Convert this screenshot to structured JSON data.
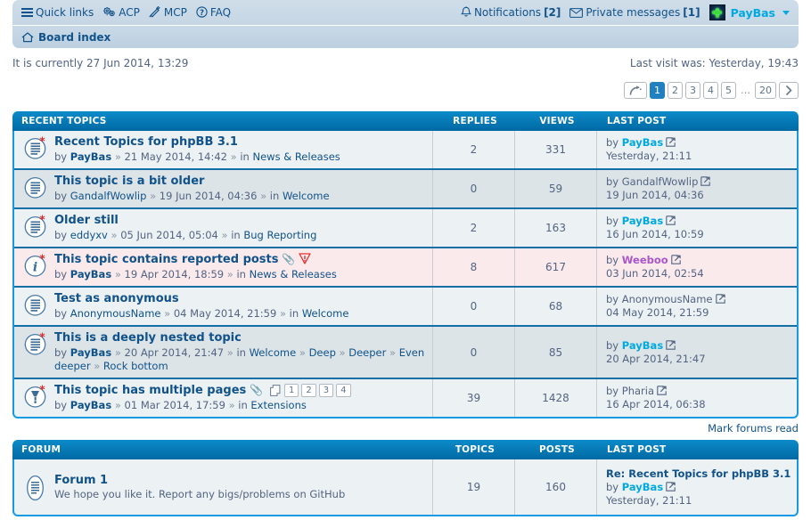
{
  "navbar": {
    "quick_links": "Quick links",
    "acp": "ACP",
    "mcp": "MCP",
    "faq": "FAQ",
    "notifications_label": "Notifications",
    "notifications_count": "[2]",
    "private_messages_label": "Private messages",
    "private_messages_count": "[1]",
    "username": "PayBas"
  },
  "breadcrumb": {
    "board_index": "Board index"
  },
  "info": {
    "current_time": "It is currently 27 Jun 2014, 13:29",
    "last_visit": "Last visit was: Yesterday, 19:43"
  },
  "pagination": {
    "pages": [
      "1",
      "2",
      "3",
      "4",
      "5"
    ],
    "ellipsis": "…",
    "last_page": "20",
    "active": "1"
  },
  "recent_topics": {
    "header": {
      "title": "RECENT TOPICS",
      "replies": "REPLIES",
      "views": "VIEWS",
      "last_post": "LAST POST"
    },
    "rows": [
      {
        "icon": "topic-unread",
        "title": "Recent Topics for phpBB 3.1",
        "by": "by",
        "author": "PayBas",
        "author_style": "strong",
        "date": "21 May 2014, 14:42",
        "in": "in",
        "forum_path": [
          "News & Releases"
        ],
        "attachment": false,
        "reported": false,
        "replies": "2",
        "views": "331",
        "lastpost_by": "by",
        "lastpost_author": "PayBas",
        "lastpost_author_style": "strong",
        "lastpost_time": "Yesterday, 21:11",
        "mini_pages": []
      },
      {
        "icon": "topic-read",
        "title": "This topic is a bit older",
        "by": "by",
        "author": "GandalfWowlip",
        "author_style": "plain",
        "date": "19 Jun 2014, 04:36",
        "in": "in",
        "forum_path": [
          "Welcome"
        ],
        "attachment": false,
        "reported": false,
        "replies": "0",
        "views": "59",
        "lastpost_by": "by",
        "lastpost_author": "GandalfWowlip",
        "lastpost_author_style": "plain",
        "lastpost_time": "19 Jun 2014, 04:36",
        "mini_pages": []
      },
      {
        "icon": "topic-unread",
        "title": "Older still",
        "by": "by",
        "author": "eddyxv",
        "author_style": "plain",
        "date": "05 Jun 2014, 05:04",
        "in": "in",
        "forum_path": [
          "Bug Reporting"
        ],
        "attachment": false,
        "reported": false,
        "replies": "2",
        "views": "163",
        "lastpost_by": "by",
        "lastpost_author": "PayBas",
        "lastpost_author_style": "strong",
        "lastpost_time": "16 Jun 2014, 10:59",
        "mini_pages": []
      },
      {
        "icon": "topic-info-unread",
        "title": "This topic contains reported posts",
        "by": "by",
        "author": "PayBas",
        "author_style": "strong",
        "date": "19 Apr 2014, 18:59",
        "in": "in",
        "forum_path": [
          "News & Releases"
        ],
        "attachment": true,
        "reported": true,
        "replies": "8",
        "views": "617",
        "lastpost_by": "by",
        "lastpost_author": "Weeboo",
        "lastpost_author_style": "mod",
        "lastpost_time": "03 Jun 2014, 02:54",
        "mini_pages": []
      },
      {
        "icon": "topic-read",
        "title": "Test as anonymous",
        "by": "by",
        "author": "AnonymousName",
        "author_style": "plain",
        "date": "04 May 2014, 21:59",
        "in": "in",
        "forum_path": [
          "Welcome"
        ],
        "attachment": false,
        "reported": false,
        "replies": "0",
        "views": "68",
        "lastpost_by": "by",
        "lastpost_author": "AnonymousName",
        "lastpost_author_style": "plain",
        "lastpost_time": "04 May 2014, 21:59",
        "mini_pages": []
      },
      {
        "icon": "topic-unread",
        "title": "This is a deeply nested topic",
        "by": "by",
        "author": "PayBas",
        "author_style": "strong",
        "date": "20 Apr 2014, 21:47",
        "in": "in",
        "forum_path": [
          "Welcome",
          "Deep",
          "Deeper",
          "Even deeper",
          "Rock bottom"
        ],
        "attachment": false,
        "reported": false,
        "replies": "0",
        "views": "85",
        "lastpost_by": "by",
        "lastpost_author": "PayBas",
        "lastpost_author_style": "strong",
        "lastpost_time": "20 Apr 2014, 21:47",
        "mini_pages": []
      },
      {
        "icon": "topic-announce-unread",
        "title": "This topic has multiple pages",
        "by": "by",
        "author": "PayBas",
        "author_style": "strong",
        "date": "01 Mar 2014, 17:59",
        "in": "in",
        "forum_path": [
          "Extensions"
        ],
        "attachment": true,
        "reported": false,
        "replies": "39",
        "views": "1428",
        "lastpost_by": "by",
        "lastpost_author": "Pharia",
        "lastpost_author_style": "plain",
        "lastpost_time": "16 Apr 2014, 06:38",
        "mini_pages": [
          "1",
          "2",
          "3",
          "4"
        ]
      }
    ]
  },
  "mark_forums_read": "Mark forums read",
  "forums": {
    "header": {
      "title": "FORUM",
      "topics": "TOPICS",
      "posts": "POSTS",
      "last_post": "LAST POST"
    },
    "rows": [
      {
        "icon": "forum-read",
        "title": "Forum 1",
        "description": "We hope you like it. Report any bigs/problems on GitHub",
        "topics": "19",
        "posts": "160",
        "lastpost_title": "Re: Recent Topics for phpBB 3.1",
        "lastpost_by": "by",
        "lastpost_author": "PayBas",
        "lastpost_author_style": "strong",
        "lastpost_time": "Yesterday, 21:11"
      }
    ]
  },
  "colors": {
    "header_blue": "#0076b1",
    "border_blue": "#139ae4",
    "link_navy": "#105289",
    "username_cyan": "#00a9e0",
    "mod_purple": "#aa55cc",
    "reported_bg": "#fbeaec",
    "row_bg": "#ecf1f3",
    "row_alt_bg": "#dce4e8",
    "navbar_bg": "#cddce8"
  }
}
